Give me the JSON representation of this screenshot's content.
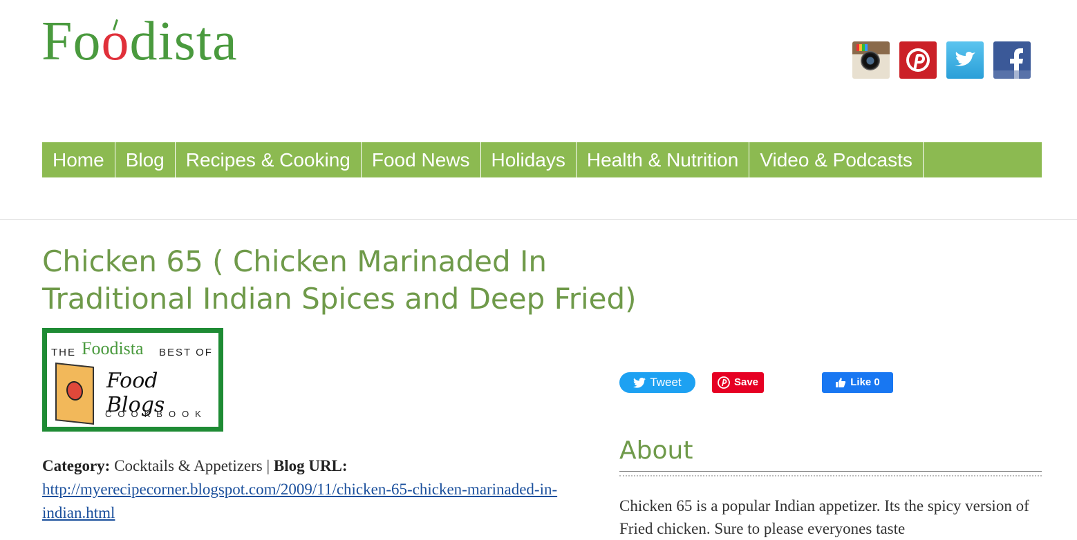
{
  "logo": {
    "text_before": "Fo",
    "text_apple": "o",
    "text_after": "dista"
  },
  "social": [
    "instagram-icon",
    "pinterest-icon",
    "twitter-icon",
    "facebook-icon"
  ],
  "nav": {
    "items": [
      "Home",
      "Blog",
      "Recipes & Cooking",
      "Food News",
      "Holidays",
      "Health & Nutrition",
      "Video & Podcasts"
    ]
  },
  "article": {
    "title": "Chicken 65 ( Chicken Marinaded In Traditional Indian Spices and Deep Fried)",
    "badge": {
      "the": "THE",
      "brand": "Foodista",
      "best_of": "BEST OF",
      "food_blogs": "Food Blogs",
      "cookbook": "COOKBOOK"
    },
    "category_label": "Category:",
    "category_value": "Cocktails & Appetizers",
    "separator": "|",
    "blog_url_label": "Blog URL:",
    "blog_url": "http://myerecipecorner.blogspot.com/2009/11/chicken-65-chicken-marinaded-in-indian.html"
  },
  "share": {
    "tweet": "Tweet",
    "save": "Save",
    "like": "Like 0"
  },
  "about": {
    "heading": "About",
    "text": "Chicken 65 is a popular Indian appetizer. Its the spicy version of Fried chicken. Sure to please everyones taste"
  },
  "colors": {
    "nav_bg": "#8cba51",
    "title": "#6f9a4a",
    "logo_green": "#4a9a3e"
  }
}
